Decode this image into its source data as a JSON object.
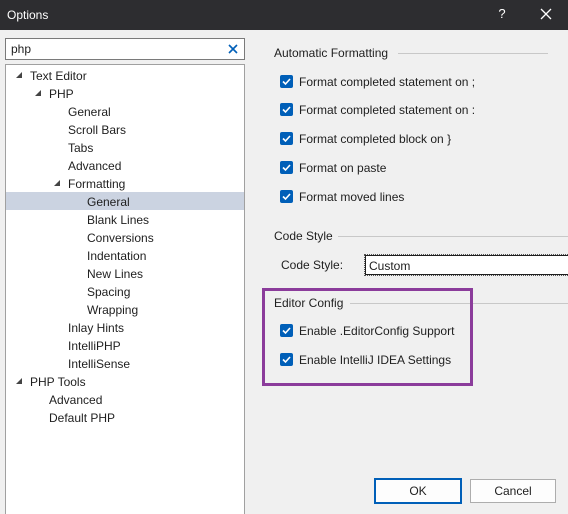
{
  "window": {
    "title": "Options",
    "help_label": "?"
  },
  "search": {
    "value": "php"
  },
  "tree": [
    {
      "label": "Text Editor",
      "expanded": true,
      "selected": false
    },
    {
      "label": "PHP",
      "expanded": true,
      "selected": false
    },
    {
      "label": "General",
      "selected": false
    },
    {
      "label": "Scroll Bars",
      "selected": false
    },
    {
      "label": "Tabs",
      "selected": false
    },
    {
      "label": "Advanced",
      "selected": false
    },
    {
      "label": "Formatting",
      "expanded": true,
      "selected": false
    },
    {
      "label": "General",
      "selected": true
    },
    {
      "label": "Blank Lines",
      "selected": false
    },
    {
      "label": "Conversions",
      "selected": false
    },
    {
      "label": "Indentation",
      "selected": false
    },
    {
      "label": "New Lines",
      "selected": false
    },
    {
      "label": "Spacing",
      "selected": false
    },
    {
      "label": "Wrapping",
      "selected": false
    },
    {
      "label": "Inlay Hints",
      "selected": false
    },
    {
      "label": "IntelliPHP",
      "selected": false
    },
    {
      "label": "IntelliSense",
      "selected": false
    },
    {
      "label": "PHP Tools",
      "expanded": true,
      "selected": false
    },
    {
      "label": "Advanced",
      "selected": false
    },
    {
      "label": "Default PHP",
      "selected": false
    }
  ],
  "automatic_formatting": {
    "heading": "Automatic Formatting",
    "options": [
      {
        "label": "Format completed statement on ;",
        "checked": true
      },
      {
        "label": "Format completed statement on :",
        "checked": true
      },
      {
        "label": "Format completed block on }",
        "checked": true
      },
      {
        "label": "Format on paste",
        "checked": true
      },
      {
        "label": "Format moved lines",
        "checked": true
      }
    ]
  },
  "code_style": {
    "heading": "Code Style",
    "label": "Code Style:",
    "value": "Custom"
  },
  "editor_config": {
    "heading": "Editor Config",
    "options": [
      {
        "label": "Enable .EditorConfig Support",
        "checked": true
      },
      {
        "label": "Enable IntelliJ IDEA Settings",
        "checked": true
      }
    ]
  },
  "buttons": {
    "ok": "OK",
    "cancel": "Cancel"
  },
  "colors": {
    "titlebar": "#2d2d30",
    "accent": "#005fb8",
    "selection": "#cbd3e1",
    "highlight_box": "#8b3c9b"
  },
  "icons": [
    "close-icon",
    "clear-search-icon",
    "expanded-arrow-icon",
    "checkmark-icon"
  ]
}
